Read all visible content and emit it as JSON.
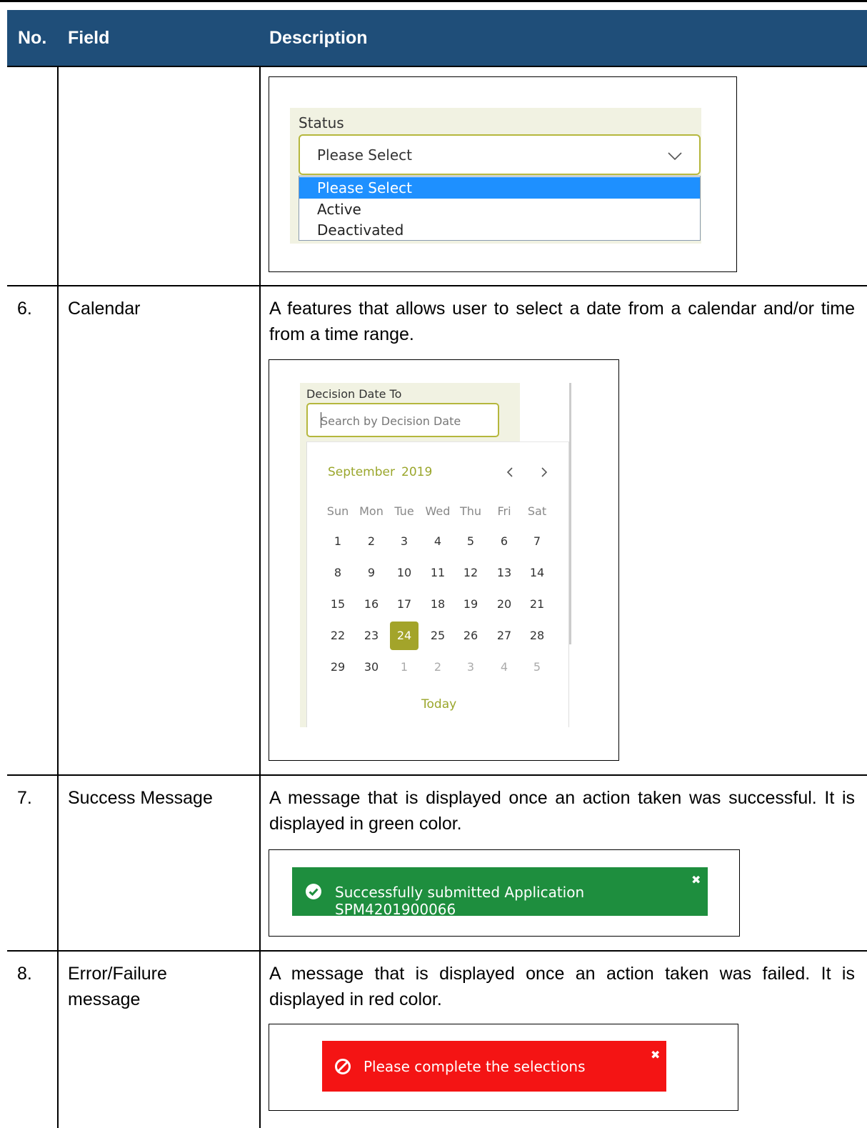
{
  "table": {
    "headers": {
      "no": "No.",
      "field": "Field",
      "description": "Description"
    },
    "rows": [
      {
        "no": "6.",
        "field": "Calendar",
        "description": "A features that allows user to select a date from a calendar and/or time from a time range."
      },
      {
        "no": "7.",
        "field": "Success Message",
        "description": "A message that is displayed once an action taken was successful. It is displayed in green color."
      },
      {
        "no": "8.",
        "field": "Error/Failure message",
        "description": "A message that is displayed once an action taken was failed. It is displayed in red color."
      }
    ]
  },
  "status_dropdown": {
    "label": "Status",
    "selected": "Please Select",
    "options": [
      "Please Select",
      "Active",
      "Deactivated"
    ],
    "icon": "chevron-down-icon"
  },
  "calendar": {
    "label": "Decision Date To",
    "placeholder": "Search by Decision Date",
    "month": "September",
    "year": "2019",
    "weekdays": [
      "Sun",
      "Mon",
      "Tue",
      "Wed",
      "Thu",
      "Fri",
      "Sat"
    ],
    "weeks": [
      [
        "1",
        "2",
        "3",
        "4",
        "5",
        "6",
        "7"
      ],
      [
        "8",
        "9",
        "10",
        "11",
        "12",
        "13",
        "14"
      ],
      [
        "15",
        "16",
        "17",
        "18",
        "19",
        "20",
        "21"
      ],
      [
        "22",
        "23",
        "24",
        "25",
        "26",
        "27",
        "28"
      ],
      [
        "29",
        "30",
        "1",
        "2",
        "3",
        "4",
        "5"
      ]
    ],
    "selected_day": "24",
    "today_label": "Today",
    "accent": "#a3a42a"
  },
  "success_alert": {
    "text": "Successfully submitted Application SPM4201900066",
    "color": "#1e8e3e",
    "icon": "check-circle-icon",
    "close": "✖"
  },
  "error_alert": {
    "text": "Please complete the selections",
    "color": "#f41414",
    "icon": "ban-icon",
    "close": "✖"
  },
  "colors": {
    "header_bg": "#1f4e79"
  }
}
